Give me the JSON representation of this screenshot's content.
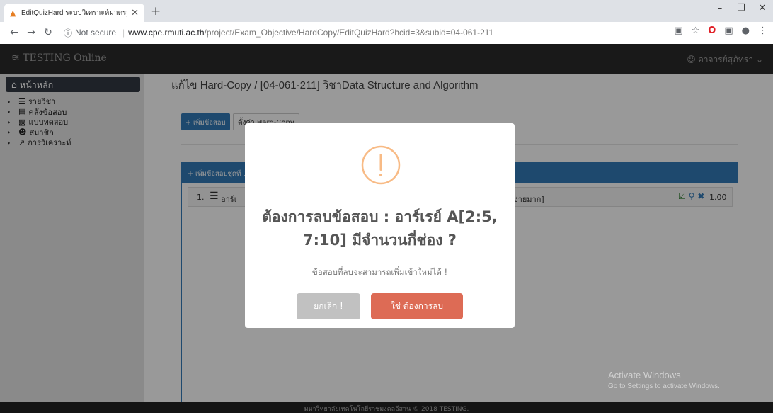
{
  "browser": {
    "tab_title": "EditQuizHard ระบบวิเคราะห์มาตรฐาน",
    "security_label": "Not secure",
    "url_host": "www.cpe.rmuti.ac.th",
    "url_path": "/project/Exam_Objective/HardCopy/EditQuizHard?hcid=3&subid=04-061-211",
    "icons": [
      "back-icon",
      "forward-icon",
      "reload-icon",
      "info-icon",
      "translate-icon",
      "star-icon",
      "opera-icon",
      "extension-icon",
      "profile-icon",
      "menu-icon"
    ]
  },
  "app": {
    "brand": "TESTING Online",
    "user": "อาจารย์สุภัทรา"
  },
  "sidebar": {
    "home": "หน้าหลัก",
    "items": [
      {
        "label": "รายวิชา",
        "icon": "list-icon"
      },
      {
        "label": "คลังข้อสอบ",
        "icon": "database-icon"
      },
      {
        "label": "แบบทดสอบ",
        "icon": "book-icon"
      },
      {
        "label": "สมาชิก",
        "icon": "users-icon"
      },
      {
        "label": "การวิเคราะห์",
        "icon": "chart-icon"
      }
    ]
  },
  "main": {
    "heading": "แก้ไข Hard-Copy / [04-061-211] วิชาData Structure and Algorithm",
    "add_question": "+ เพิ่มข้อสอบ",
    "settings": "ตั้งค่า Hard-Copy",
    "panel_title": "+ เพิ่มข้อสอบชุดที่ 1",
    "question": {
      "number": "1.",
      "text": "อาร์เ",
      "level": "[ง่ายมาก]",
      "score": "1.00"
    }
  },
  "modal": {
    "title": "ต้องการลบข้อสอบ : อาร์เรย์ A[2:5, 7:10] มีจำนวนกี่ช่อง ?",
    "text": "ข้อสอบที่ลบจะสามารถเพิ่มเข้าใหม่ได้ !",
    "cancel": "ยกเลิก !",
    "confirm": "ใช่ ต้องการลบ",
    "icon_color": "#f8bb86"
  },
  "footer": "มหาวิทยาลัยเทคโนโลยีราชมงคลอีสาน © 2018 TESTING.",
  "watermark": {
    "title": "Activate Windows",
    "sub": "Go to Settings to activate Windows."
  }
}
